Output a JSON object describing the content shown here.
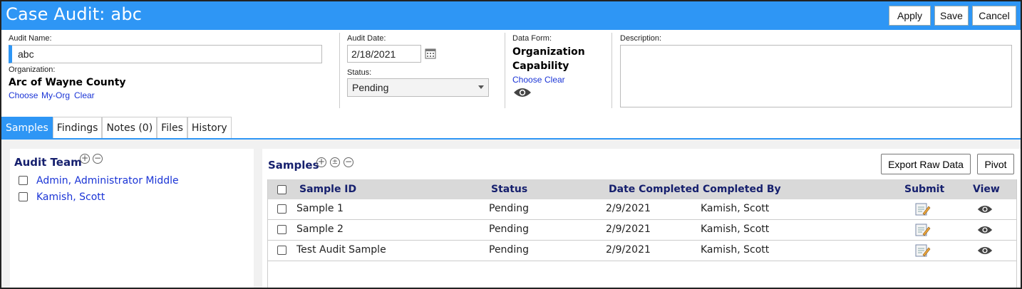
{
  "header": {
    "title": "Case Audit: abc",
    "apply": "Apply",
    "save": "Save",
    "cancel": "Cancel"
  },
  "form": {
    "audit_name_label": "Audit Name:",
    "audit_name_value": "abc",
    "organization_label": "Organization:",
    "organization_value": "Arc of Wayne County",
    "org_links": [
      "Choose",
      "My-Org",
      "Clear"
    ],
    "audit_date_label": "Audit Date:",
    "audit_date_value": "2/18/2021",
    "status_label": "Status:",
    "status_value": "Pending",
    "data_form_label": "Data Form:",
    "data_form_value_line1": "Organization",
    "data_form_value_line2": "Capability",
    "data_form_links": [
      "Choose",
      "Clear"
    ],
    "description_label": "Description:",
    "description_value": ""
  },
  "tabs": [
    "Samples",
    "Findings",
    "Notes (0)",
    "Files",
    "History"
  ],
  "active_tab": "Samples",
  "audit_team": {
    "title": "Audit Team",
    "members": [
      "Admin, Administrator Middle",
      "Kamish, Scott"
    ]
  },
  "samples": {
    "title": "Samples",
    "export_label": "Export Raw Data",
    "pivot_label": "Pivot",
    "columns": [
      "Sample ID",
      "Status",
      "Date Completed",
      "Completed By",
      "Submit",
      "View"
    ],
    "rows": [
      {
        "id": "Sample 1",
        "status": "Pending",
        "date": "2/9/2021",
        "by": "Kamish, Scott"
      },
      {
        "id": "Sample 2",
        "status": "Pending",
        "date": "2/9/2021",
        "by": "Kamish, Scott"
      },
      {
        "id": "Test Audit Sample",
        "status": "Pending",
        "date": "2/9/2021",
        "by": "Kamish, Scott"
      }
    ]
  },
  "icons": {
    "calendar": "calendar-icon",
    "dropdown": "chevron-down-icon",
    "eye": "eye-icon",
    "submit": "edit-form-icon"
  },
  "colors": {
    "accent": "#2e96f5",
    "link": "#1a34d6",
    "heading": "#16206e"
  }
}
